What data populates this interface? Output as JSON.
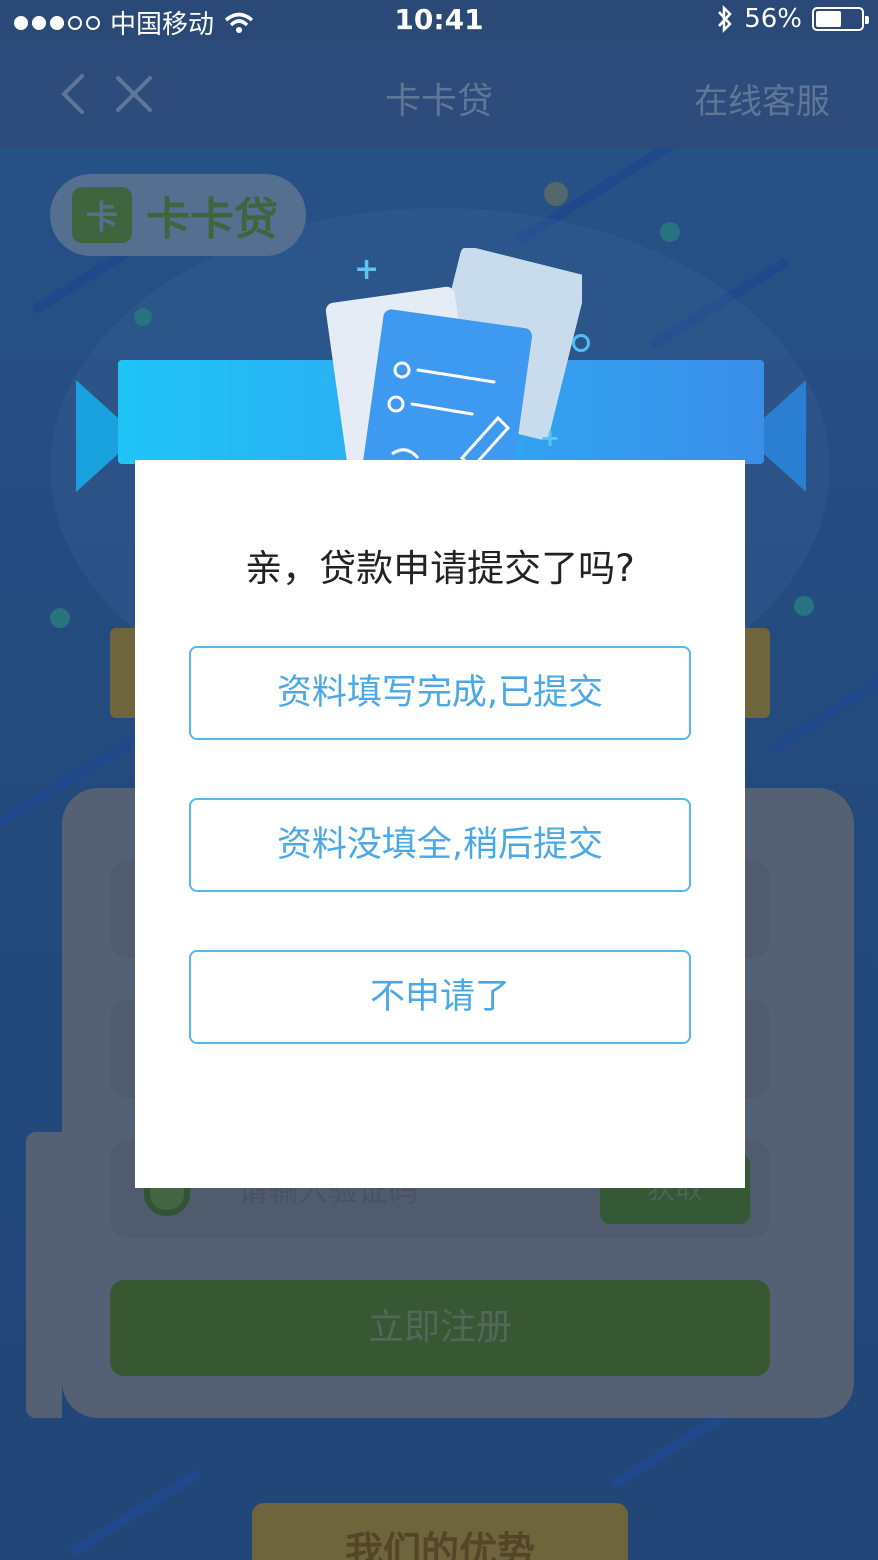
{
  "status_bar": {
    "carrier": "中国移动",
    "time": "10:41",
    "battery_percent": "56%",
    "battery_level": 0.56,
    "icons": [
      "signal-dots-icon",
      "wifi-icon",
      "bluetooth-icon",
      "battery-icon"
    ]
  },
  "nav": {
    "title": "卡卡贷",
    "service_label": "在线客服",
    "back_icon": "chevron-left-icon",
    "close_icon": "close-icon"
  },
  "background_page": {
    "logo_text": "卡卡贷",
    "code_placeholder": "请输入验证码",
    "get_code_label": "获取",
    "register_label": "立即注册",
    "advantages_label": "我们的优势"
  },
  "modal": {
    "title": "亲，贷款申请提交了吗?",
    "options": [
      {
        "label": "资料填写完成,已提交"
      },
      {
        "label": "资料没填全,稍后提交"
      },
      {
        "label": "不申请了"
      }
    ]
  },
  "colors": {
    "nav_bg": "#2d4c7b",
    "accent_blue": "#4aa8e6",
    "option_border": "#5ab6ec",
    "register_green": "#44692e"
  }
}
